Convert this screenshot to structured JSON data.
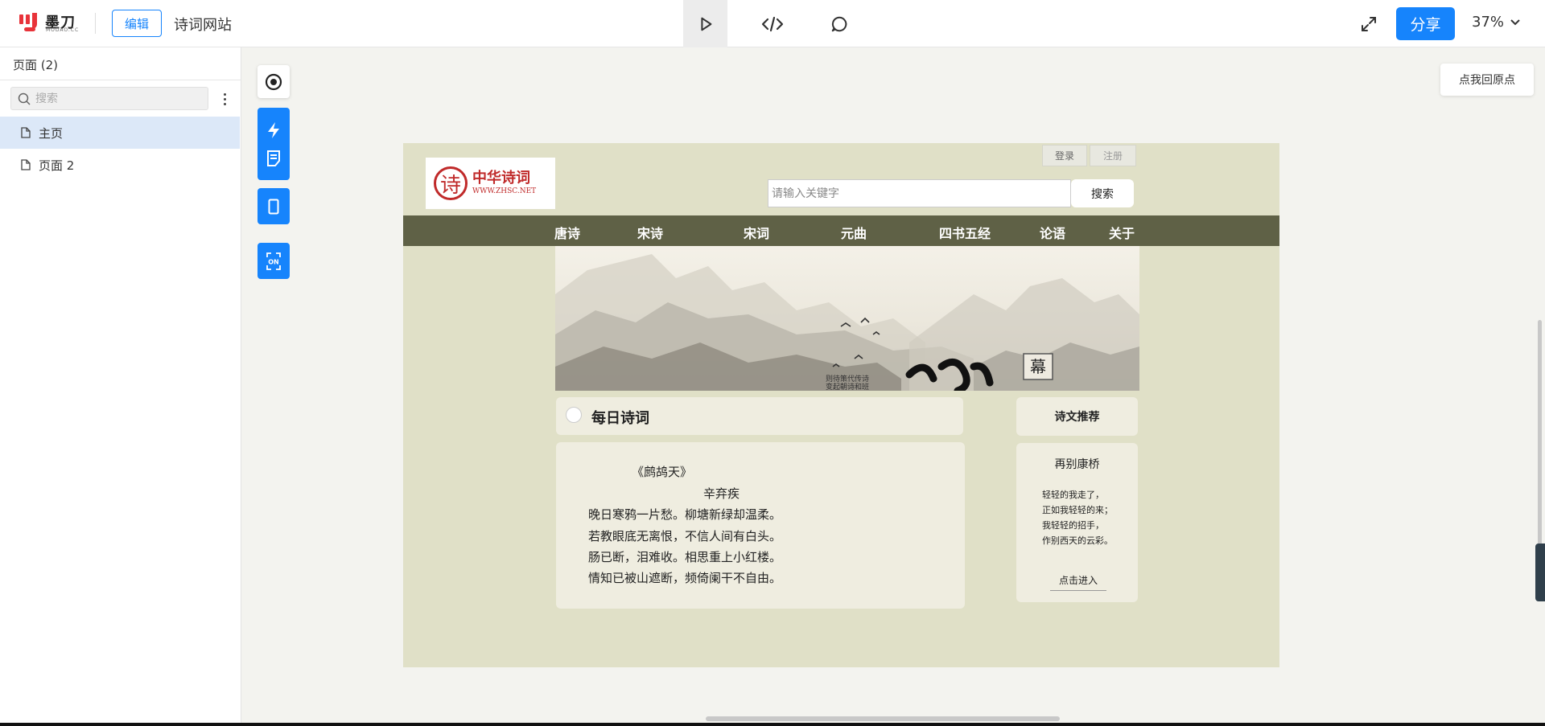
{
  "topbar": {
    "logo_text": "墨刀",
    "logo_sub": "MODAO.CC",
    "edit_label": "编辑",
    "project_title": "诗词网站",
    "share_label": "分享",
    "zoom": "37%"
  },
  "sidebar": {
    "header": "页面 (2)",
    "search_placeholder": "搜索",
    "pages": [
      {
        "label": "主页",
        "active": true
      },
      {
        "label": "页面 2",
        "active": false
      }
    ]
  },
  "canvas_controls": {
    "home_label": "点我回原点"
  },
  "site": {
    "logo_name": "中华诗词",
    "logo_url": "WWW.ZHSC.NET",
    "logo_glyph": "诗",
    "login": "登录",
    "register": "注册",
    "search_placeholder": "请输入关键字",
    "search_button": "搜索",
    "nav": [
      "唐诗",
      "宋诗",
      "宋词",
      "元曲",
      "四书五经",
      "论语",
      "关于"
    ],
    "banner_glyph": "幕",
    "banner_small_1": "则待策代传诗",
    "banner_small_2": "变起朝诗和班",
    "daily": {
      "title": "每日诗词",
      "poem_title": "《鹧鸪天》",
      "author": "辛弃疾",
      "lines": [
        "晚日寒鸦一片愁。柳塘新绿却温柔。",
        "若教眼底无离恨，不信人间有白头。",
        "肠已断，泪难收。相思重上小红楼。",
        "情知已被山遮断，频倚阑干不自由。"
      ]
    },
    "recommend": {
      "title": "诗文推荐",
      "poem_title": "再别康桥",
      "lines": [
        "轻轻的我走了，",
        "正如我轻轻的来；",
        "我轻轻的招手，",
        "作别西天的云彩。"
      ],
      "link": "点击进入"
    }
  },
  "colors": {
    "accent": "#1684fc",
    "canvas_bg": "#e0e0c7",
    "nav_bg": "#5f6146",
    "card_bg": "#efede0",
    "logo_red": "#c02a2a"
  }
}
